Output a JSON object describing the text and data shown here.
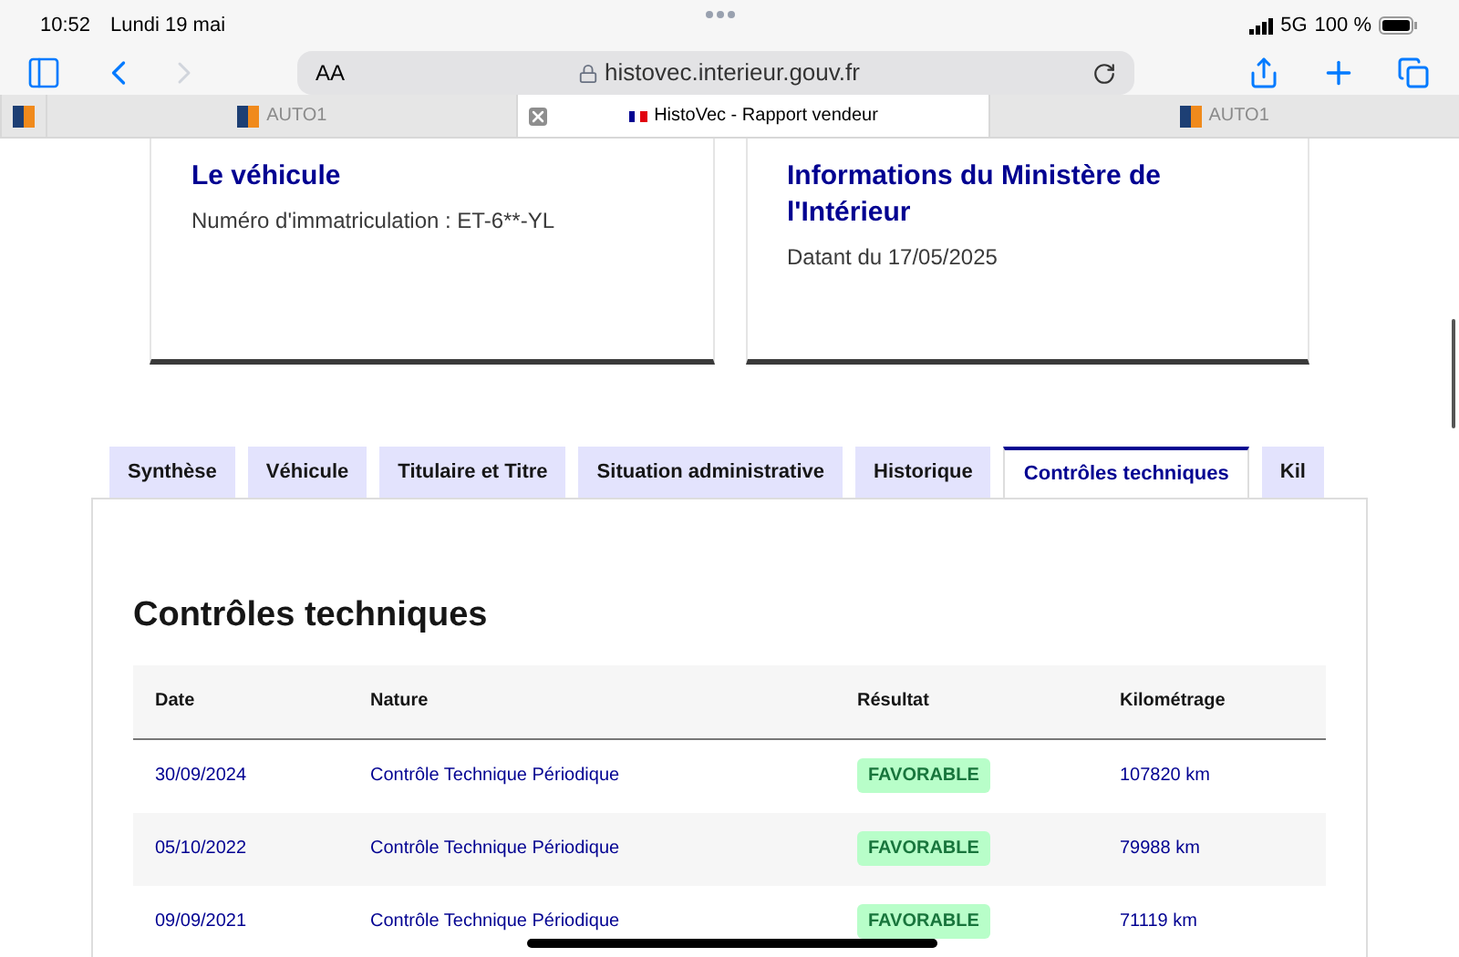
{
  "status_bar": {
    "time": "10:52",
    "date": "Lundi 19 mai",
    "network": "5G",
    "battery": "100 %"
  },
  "toolbar": {
    "text_size": "AA",
    "address": "histovec.interieur.gouv.fr"
  },
  "browser_tabs": [
    {
      "selected": false
    },
    {
      "title": "AUTO1",
      "selected": false
    },
    {
      "title": "HistoVec - Rapport vendeur",
      "selected": true
    },
    {
      "title": "AUTO1",
      "selected": false
    }
  ],
  "cards": [
    {
      "title": "Le véhicule",
      "text": "Numéro d'immatriculation : ET-6**-YL"
    },
    {
      "title": "Informations du Ministère de l'Intérieur",
      "text": "Datant du 17/05/2025"
    }
  ],
  "tabs": [
    {
      "label": "Synthèse",
      "selected": false
    },
    {
      "label": "Véhicule",
      "selected": false
    },
    {
      "label": "Titulaire et Titre",
      "selected": false
    },
    {
      "label": "Situation administrative",
      "selected": false
    },
    {
      "label": "Historique",
      "selected": false
    },
    {
      "label": "Contrôles techniques",
      "selected": true
    },
    {
      "label": "Kil",
      "selected": false
    }
  ],
  "section_title": "Contrôles techniques",
  "table": {
    "columns": [
      "Date",
      "Nature",
      "Résultat",
      "Kilométrage"
    ],
    "rows": [
      {
        "date": "30/09/2024",
        "nature": "Contrôle Technique Périodique",
        "result": {
          "text": "FAVORABLE",
          "kind": "success"
        },
        "mileage": "107820 km"
      },
      {
        "date": "05/10/2022",
        "nature": "Contrôle Technique Périodique",
        "result": {
          "text": "FAVORABLE",
          "kind": "success"
        },
        "mileage": "79988 km"
      },
      {
        "date": "09/09/2021",
        "nature": "Contrôle Technique Périodique",
        "result": {
          "text": "FAVORABLE",
          "kind": "success"
        },
        "mileage": "71119 km"
      }
    ]
  }
}
